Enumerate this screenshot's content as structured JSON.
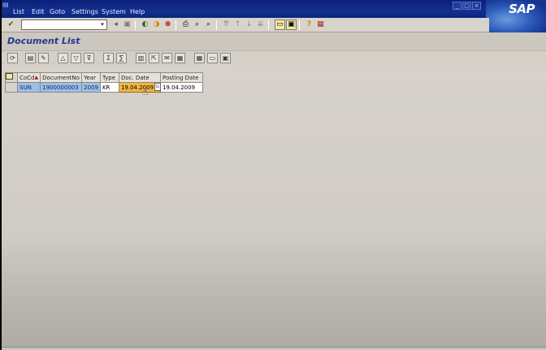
{
  "menu": {
    "items": [
      {
        "label": "List"
      },
      {
        "label": "Edit"
      },
      {
        "label": "Goto"
      },
      {
        "label": "Settings"
      },
      {
        "label": "System"
      },
      {
        "label": "Help"
      }
    ]
  },
  "brand": {
    "logo_text": "SAP"
  },
  "command_field": {
    "value": ""
  },
  "title": {
    "text": "Document List"
  },
  "table": {
    "columns": [
      "CoCd",
      "DocumentNo",
      "Year",
      "Type",
      "Doc. Date",
      "Posting Date"
    ],
    "sort_column": "CoCd",
    "rows": [
      {
        "cocd": "SUN",
        "document_no": "1900000003",
        "year": "2009",
        "type": "KR",
        "doc_date": "19.04.2009",
        "posting_date": "19.04.2009"
      }
    ]
  },
  "colors": {
    "menubar": "#123090",
    "key_cell": "#9bbfe6",
    "highlight_cell": "#f3b63f",
    "title_text": "#1f3a8a"
  },
  "icons": {
    "standard_toolbar": [
      "enter-icon",
      "save-icon",
      "back-icon",
      "exit-icon",
      "cancel-icon",
      "print-icon",
      "find-icon",
      "find-next-icon",
      "first-page-icon",
      "previous-page-icon",
      "next-page-icon",
      "last-page-icon",
      "create-session-icon",
      "shortcut-icon",
      "help-icon",
      "layout-menu-icon"
    ],
    "application_toolbar": [
      "refresh-icon",
      "display-document-icon",
      "change-document-icon",
      "sort-ascending-icon",
      "set-filter-icon",
      "filter-icon",
      "subtotal-icon",
      "total-icon",
      "print-preview-icon",
      "export-icon",
      "send-icon",
      "word-processing-icon",
      "abc-analysis-icon",
      "layout-icon",
      "choose-layout-icon",
      "save-layout-icon"
    ]
  }
}
